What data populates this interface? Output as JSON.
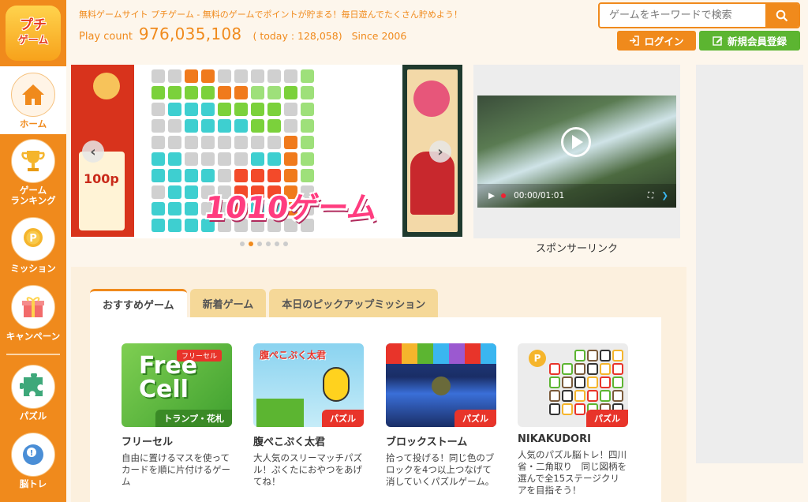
{
  "logo": {
    "line1": "プチ",
    "line2": "ゲーム"
  },
  "header": {
    "tagline": "無料ゲームサイト プチゲーム - 無料のゲームでポイントが貯まる！毎日遊んでたくさん貯めよう！",
    "play_count_label": "Play count",
    "play_count": "976,035,108",
    "today": "( today : 128,058)",
    "since": "Since 2006"
  },
  "search": {
    "placeholder": "ゲームをキーワードで検索",
    "icon": "search-icon"
  },
  "auth": {
    "login": "ログイン",
    "signup": "新規会員登録"
  },
  "sidebar": {
    "items": [
      {
        "label": "ホーム",
        "icon": "home-icon"
      },
      {
        "label": "ゲーム\nランキング",
        "icon": "trophy-icon"
      },
      {
        "label": "ミッション",
        "icon": "medal-icon"
      },
      {
        "label": "キャンペーン",
        "icon": "gift-icon"
      },
      {
        "label": "パズル",
        "icon": "puzzle-icon"
      },
      {
        "label": "脳トレ",
        "icon": "brain-icon"
      }
    ]
  },
  "carousel": {
    "main_title": "1010ゲーム",
    "left_promo": "100p",
    "dot_count": 6,
    "active_dot": 2
  },
  "sponsor": {
    "label": "スポンサーリンク",
    "video_time": "00:00/01:01"
  },
  "tabs": [
    {
      "label": "おすすめゲーム",
      "active": true
    },
    {
      "label": "新着ゲーム",
      "active": false
    },
    {
      "label": "本日のピックアップミッション",
      "active": false
    }
  ],
  "games": [
    {
      "title": "フリーセル",
      "desc": "自由に置けるマスを使ってカードを順に片付けるゲーム",
      "thumb_text1": "Free",
      "thumb_text2": "Cell",
      "thumb_top": "フリーセル",
      "thumb_badge": "トランプ・花札"
    },
    {
      "title": "腹ぺこぷく太君",
      "desc": "大人気のスリーマッチパズル！ぷくたにおやつをあげてね！",
      "thumb_top": "腹ぺこぷく太君",
      "badge": "パズル"
    },
    {
      "title": "ブロックストーム",
      "desc": "拾って投げる！同じ色のブロックを4つ以上つなげて消していくパズルゲーム。",
      "badge": "パズル"
    },
    {
      "title": "NIKAKUDORI",
      "desc": "人気のパズル脳トレ！四川省・二角取り　同じ図柄を選んで全15ステージクリアを目指そう！",
      "badge": "パズル"
    }
  ],
  "colors": {
    "brand": "#f08a1c",
    "green": "#5cb531",
    "badge_red": "#e8342a"
  }
}
